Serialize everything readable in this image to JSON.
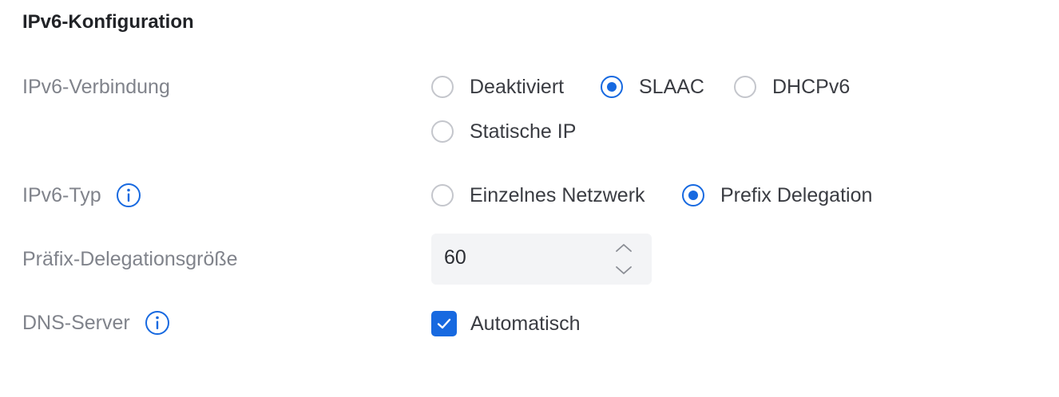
{
  "section": {
    "title": "IPv6-Konfiguration"
  },
  "ipv6_connection": {
    "label": "IPv6-Verbindung",
    "options": [
      {
        "label": "Deaktiviert",
        "selected": false
      },
      {
        "label": "SLAAC",
        "selected": true
      },
      {
        "label": "DHCPv6",
        "selected": false
      },
      {
        "label": "Statische IP",
        "selected": false
      }
    ]
  },
  "ipv6_type": {
    "label": "IPv6-Typ",
    "info_icon": "info-icon",
    "options": [
      {
        "label": "Einzelnes Netzwerk",
        "selected": false
      },
      {
        "label": "Prefix Delegation",
        "selected": true
      }
    ]
  },
  "prefix_size": {
    "label": "Präfix-Delegationsgröße",
    "value": "60",
    "up_icon": "chevron-up-icon",
    "down_icon": "chevron-down-icon"
  },
  "dns": {
    "label": "DNS-Server",
    "info_icon": "info-icon",
    "checkbox_label": "Automatisch",
    "checked": true
  },
  "colors": {
    "accent": "#1769e0",
    "label_gray": "#80838b",
    "radio_border": "#c4c6cc",
    "field_bg": "#f3f4f6"
  }
}
